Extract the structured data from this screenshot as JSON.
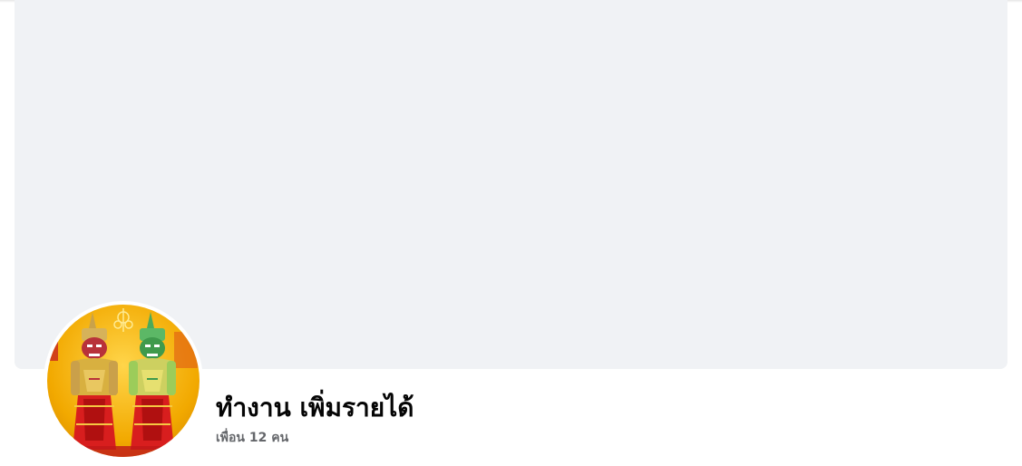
{
  "profile": {
    "name": "ทำงาน เพิ่มรายได้",
    "friends_text": "เพื่อน 12 คน"
  },
  "cover": {
    "color": "#f0f2f5"
  },
  "avatar": {
    "icon": "giant-guardians-avatar",
    "background_color": "#f2b400",
    "accent_color": "#d81e1e"
  }
}
